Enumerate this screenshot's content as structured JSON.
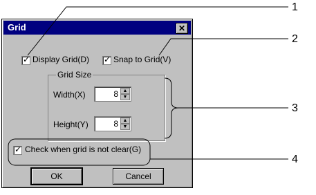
{
  "dialog": {
    "title": "Grid",
    "close_glyph": "✕",
    "display_grid_label": "Display Grid(D)",
    "snap_to_grid_label": "Snap to Grid(V)",
    "grid_size_label": "Grid Size",
    "width_label": "Width(X)",
    "width_value": "8",
    "height_label": "Height(Y)",
    "height_value": "8",
    "check_grid_label": "Check when grid is not clear(G)",
    "ok_label": "OK",
    "cancel_label": "Cancel"
  },
  "callouts": [
    "1",
    "2",
    "3",
    "4"
  ]
}
